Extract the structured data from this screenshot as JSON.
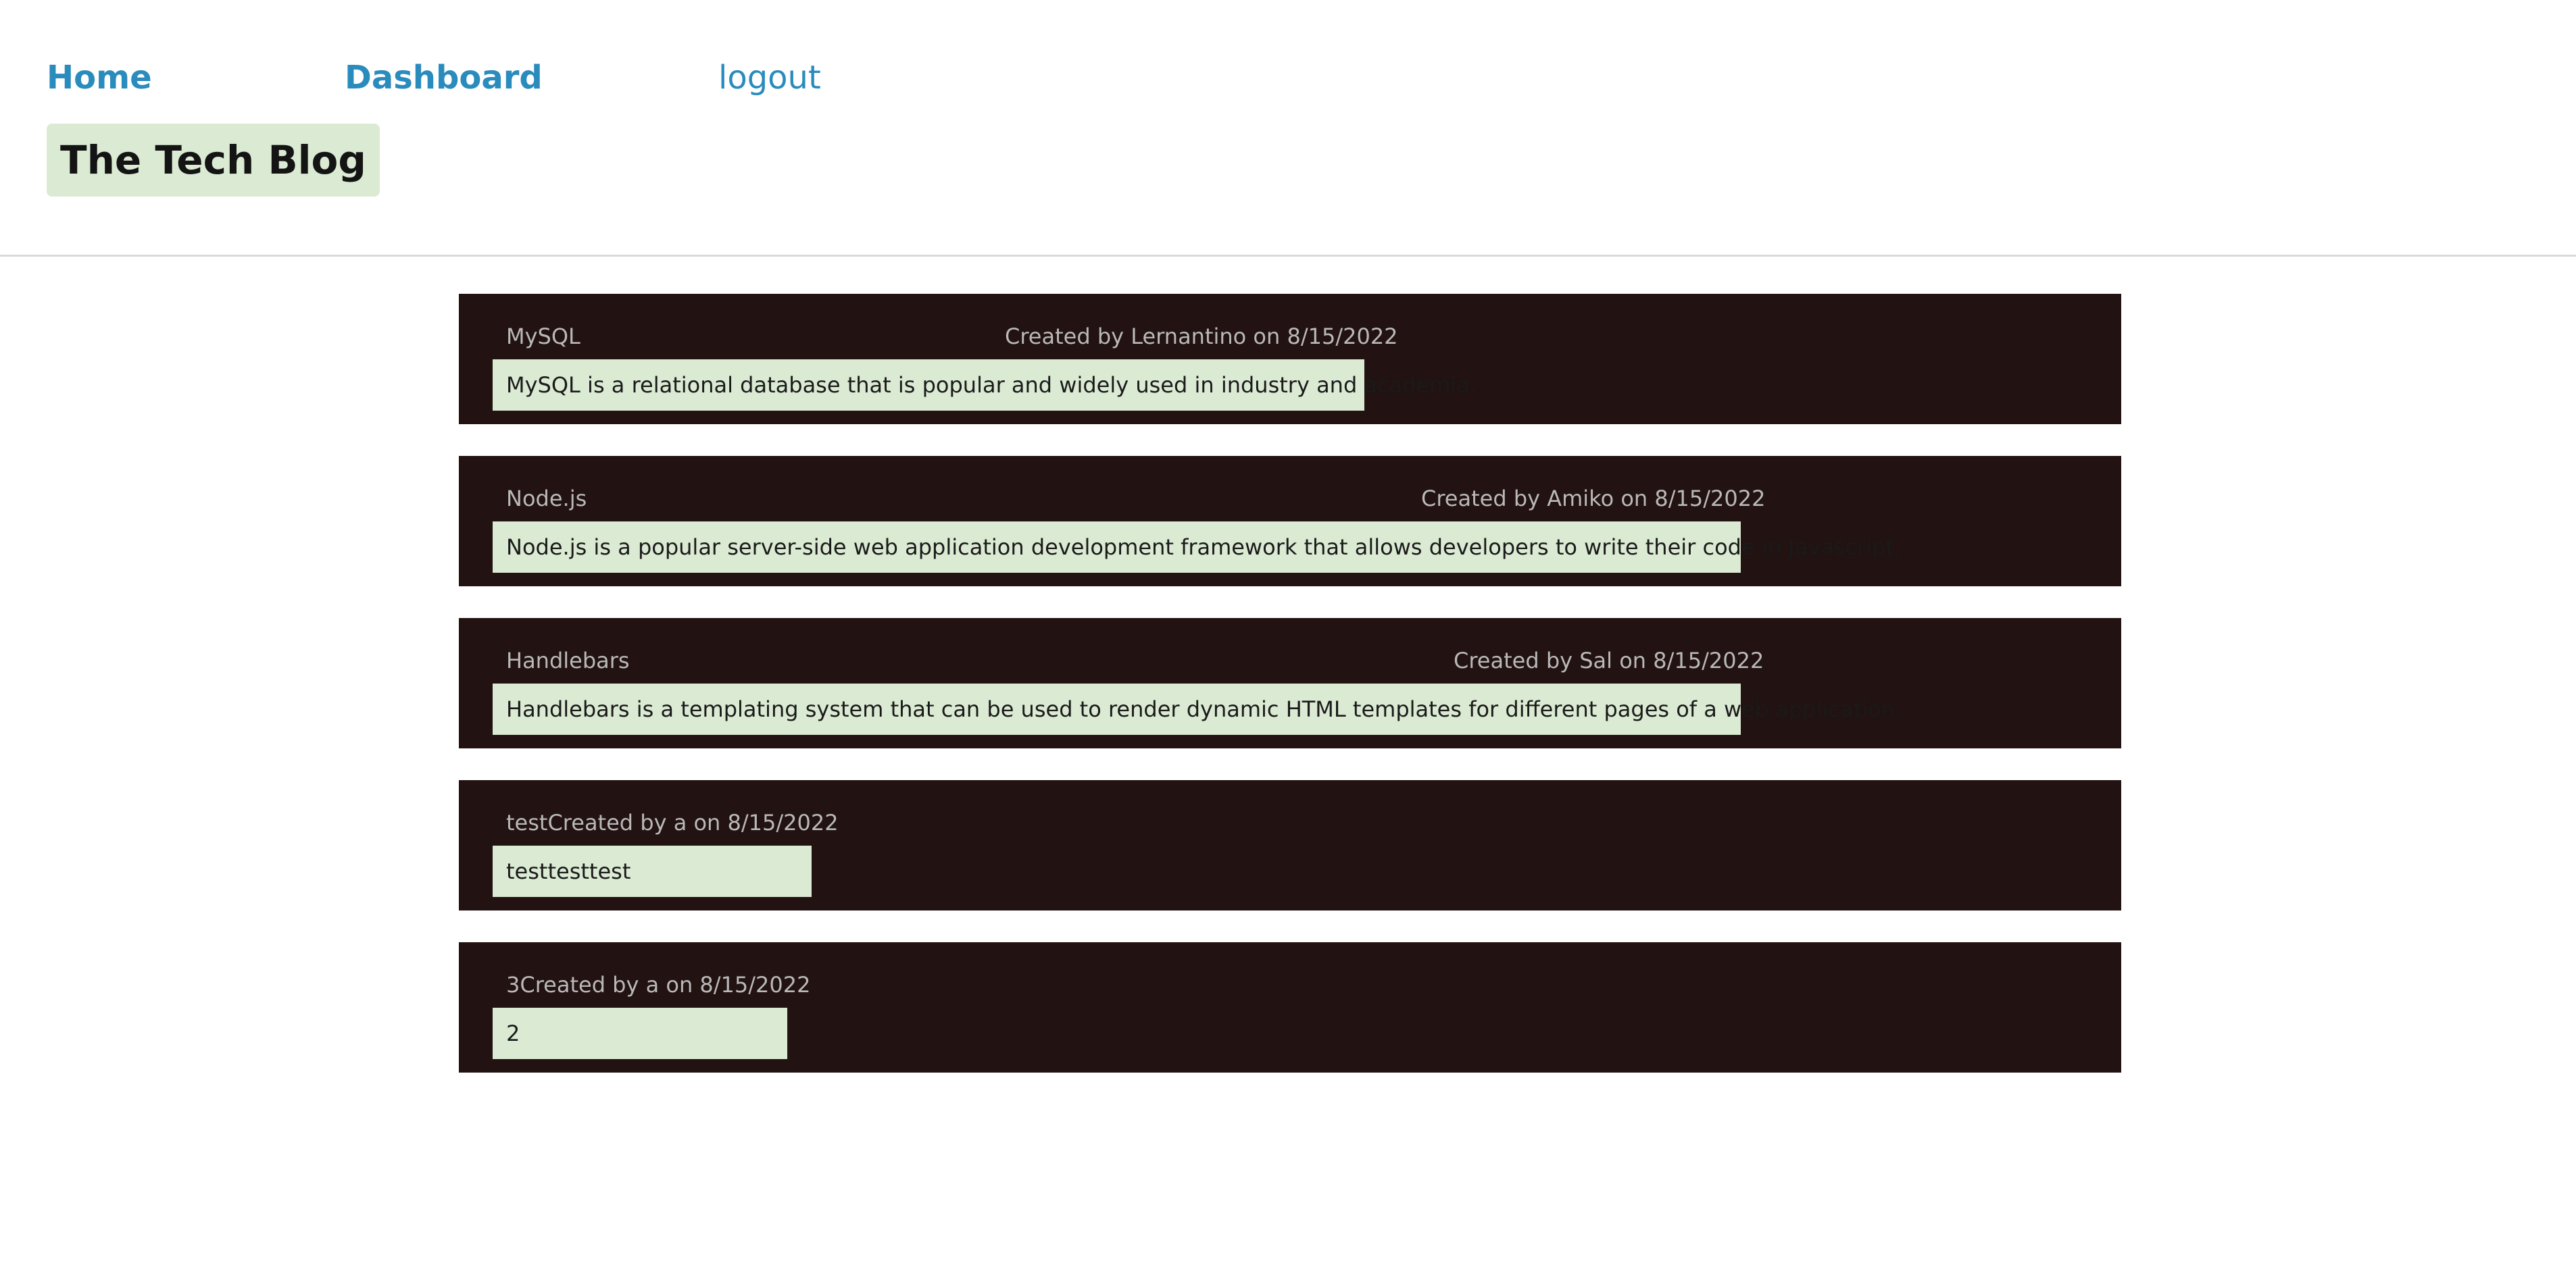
{
  "nav": {
    "home": "Home",
    "dashboard": "Dashboard",
    "logout": "logout"
  },
  "brand": "The Tech Blog",
  "posts": [
    {
      "title": "MySQL",
      "meta": "Created by Lernantino on 8/15/2022",
      "body": "MySQL is a relational database that is popular and widely used in industry and academia."
    },
    {
      "title": "Node.js",
      "meta": "Created by Amiko on 8/15/2022",
      "body": "Node.js is a popular server-side web application development framework that allows developers to write their code in Javascript."
    },
    {
      "title": "Handlebars",
      "meta": "Created by Sal on 8/15/2022",
      "body": "Handlebars is a templating system that can be used to render dynamic HTML templates for different pages of a web application."
    },
    {
      "title": "test",
      "meta": "Created by a on 8/15/2022",
      "body": "testtesttest"
    },
    {
      "title": "3",
      "meta": "Created by a on 8/15/2022",
      "body": "2"
    }
  ],
  "colors": {
    "link": "#2a8bbd",
    "brand_bg": "#dbead3",
    "post_bg": "#221211",
    "post_body_bg": "#dbead3"
  }
}
